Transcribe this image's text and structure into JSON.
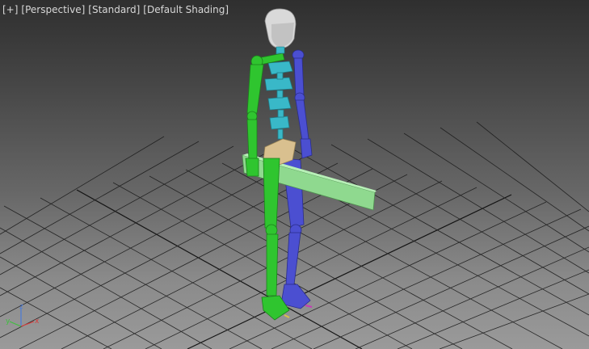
{
  "viewport": {
    "labels": {
      "plus": "[+]",
      "view": "[Perspective]",
      "mode": "[Standard]",
      "shading": "[Default Shading]"
    }
  },
  "axis": {
    "x_label": "x",
    "y_label": "y",
    "z_label": "z",
    "x_color": "#d93c3c",
    "y_color": "#3fbf3f",
    "z_color": "#4a7bd9"
  },
  "colors": {
    "left_side": "#2fc52f",
    "right_side": "#4b4fd1",
    "spine": "#39b8c8",
    "pelvis": "#d9c08f",
    "head": "#d9d9d9",
    "prop": "#8fd98f",
    "grid": "#111111"
  }
}
